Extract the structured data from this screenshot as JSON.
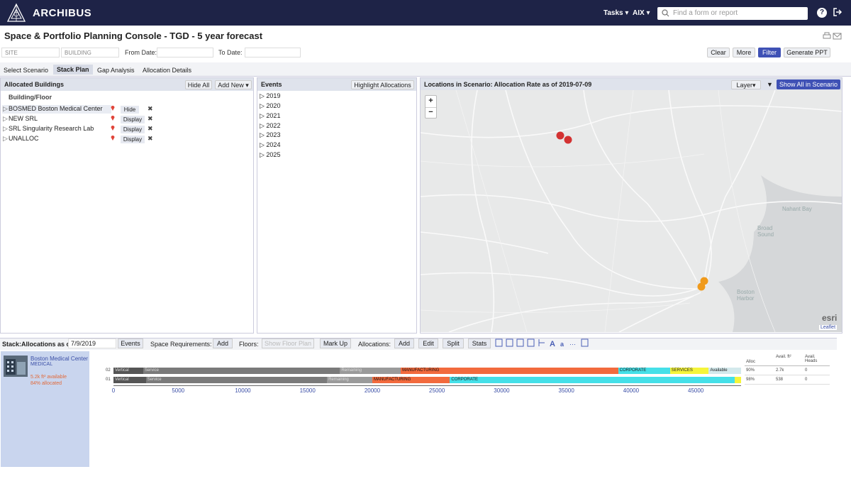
{
  "app": {
    "brand": "ARCHIBUS",
    "nav_tasks": "Tasks ▾",
    "nav_user": "AIX ▾",
    "search_placeholder": "Find a form or report"
  },
  "page": {
    "title": "Space & Portfolio Planning Console - TGD - 5 year forecast"
  },
  "filters": {
    "site_placeholder": "SITE",
    "building_placeholder": "BUILDING",
    "from_label": "From Date:",
    "to_label": "To Date:",
    "clear": "Clear",
    "more": "More",
    "filter": "Filter",
    "generate": "Generate PPT"
  },
  "tabs": [
    "Select Scenario",
    "Stack Plan",
    "Gap Analysis",
    "Allocation Details"
  ],
  "buildings_panel": {
    "title": "Allocated Buildings",
    "hide_all": "Hide All",
    "add_new": "Add New ▾",
    "column": "Building/Floor",
    "rows": [
      {
        "label": "BOSMED Boston Medical Center",
        "action": "Hide"
      },
      {
        "label": "NEW SRL",
        "action": "Display"
      },
      {
        "label": "SRL Singularity Research Lab",
        "action": "Display"
      },
      {
        "label": "UNALLOC",
        "action": "Display"
      }
    ]
  },
  "events_panel": {
    "title": "Events",
    "highlight": "Highlight Allocations",
    "years": [
      "2019",
      "2020",
      "2021",
      "2022",
      "2023",
      "2024",
      "2025"
    ]
  },
  "map_panel": {
    "title": "Locations in Scenario: Allocation Rate as of 2019-07-09",
    "layer": "Layer▾",
    "show_all": "Show All in Scenario",
    "zoom_in": "+",
    "zoom_out": "−",
    "labels": [
      "Nahant Bay",
      "Broad Sound",
      "Boston Harbor"
    ],
    "attribution": "Leaflet",
    "esri": "esri",
    "marker_colors": {
      "red": "#d33232",
      "orange": "#f09a1b"
    }
  },
  "stack": {
    "title": "Stack:Allocations as of:",
    "date": "7/9/2019",
    "events": "Events",
    "space_req_label": "Space Requirements:",
    "add": "Add",
    "floors_label": "Floors:",
    "show_floor_plan": "Show Floor Plan",
    "mark_up": "Mark Up",
    "allocations_label": "Allocations:",
    "alloc_add": "Add",
    "edit": "Edit",
    "split": "Split",
    "stats": "Stats",
    "building_name": "Boston Medical Center",
    "building_type": "MEDICAL",
    "available": "5.2k ft² available",
    "allocated": "84% allocated",
    "side_headers": [
      "Alloc",
      "Avail. ft²",
      "Avail. Heads"
    ],
    "floors": [
      {
        "floor": "02",
        "alloc": "90%",
        "avail_ft": "2.7k",
        "avail_heads": "0",
        "segments": [
          {
            "label": "Vertical",
            "from": 0,
            "to": 2300,
            "color": "#555555"
          },
          {
            "label": "Service",
            "from": 2300,
            "to": 17500,
            "color": "#7a7a7a"
          },
          {
            "label": "Remaining",
            "from": 17500,
            "to": 22200,
            "color": "#9a9a9a"
          },
          {
            "label": "MANUFACTURING",
            "from": 22200,
            "to": 39000,
            "color": "#f26a3d"
          },
          {
            "label": "CORPORATE",
            "from": 39000,
            "to": 43000,
            "color": "#45e0e8"
          },
          {
            "label": "SERVICES",
            "from": 43000,
            "to": 46000,
            "color": "#f5f53a"
          },
          {
            "label": "Available",
            "from": 46000,
            "to": 48500,
            "color": "#d3e9ec"
          }
        ]
      },
      {
        "floor": "01",
        "alloc": "98%",
        "avail_ft": "538",
        "avail_heads": "0",
        "segments": [
          {
            "label": "Vertical",
            "from": 0,
            "to": 2500,
            "color": "#555555"
          },
          {
            "label": "Service",
            "from": 2500,
            "to": 16500,
            "color": "#7a7a7a"
          },
          {
            "label": "Remaining",
            "from": 16500,
            "to": 20000,
            "color": "#9a9a9a"
          },
          {
            "label": "MANUFACTURING",
            "from": 20000,
            "to": 26000,
            "color": "#f26a3d"
          },
          {
            "label": "CORPORATE",
            "from": 26000,
            "to": 48000,
            "color": "#45e0e8"
          },
          {
            "label": "",
            "from": 48000,
            "to": 48500,
            "color": "#f5f53a"
          }
        ]
      }
    ],
    "axis_ticks": [
      "0",
      "5000",
      "10000",
      "15000",
      "20000",
      "25000",
      "30000",
      "35000",
      "40000",
      "45000"
    ]
  }
}
